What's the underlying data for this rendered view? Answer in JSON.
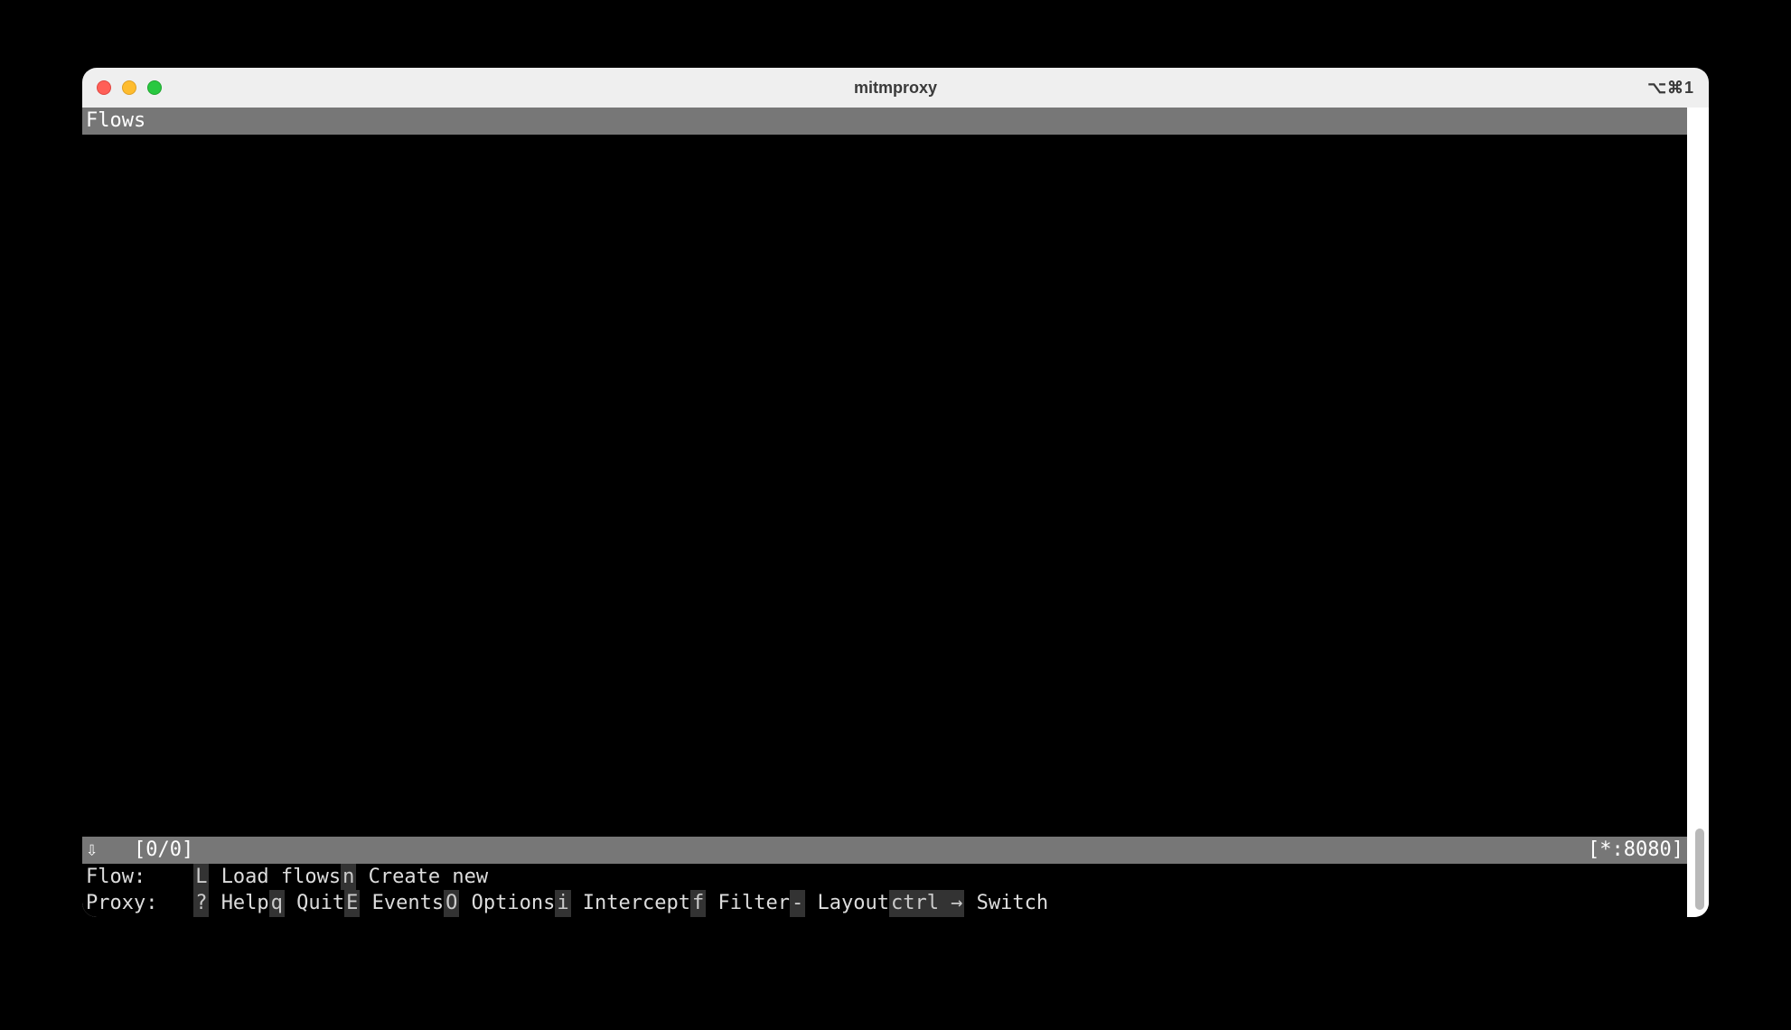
{
  "titlebar": {
    "title": "mitmproxy",
    "shortcut_indicator": "⌥⌘1"
  },
  "header": {
    "label": "Flows"
  },
  "status": {
    "left_arrow": "⇩",
    "counter": "[0/0]",
    "listen": "[*:8080]"
  },
  "flow_row": {
    "label": "Flow:",
    "items": [
      {
        "key": "L",
        "label": "Load flows"
      },
      {
        "key": "n",
        "label": "Create new"
      }
    ]
  },
  "proxy_row": {
    "label": "Proxy:",
    "items": [
      {
        "key": "?",
        "label": "Help"
      },
      {
        "key": "q",
        "label": "Quit"
      },
      {
        "key": "E",
        "label": "Events"
      },
      {
        "key": "O",
        "label": "Options"
      },
      {
        "key": "i",
        "label": "Intercept"
      },
      {
        "key": "f",
        "label": "Filter"
      },
      {
        "key": "-",
        "label": "Layout"
      },
      {
        "key": "ctrl →",
        "label": "Switch"
      }
    ]
  }
}
